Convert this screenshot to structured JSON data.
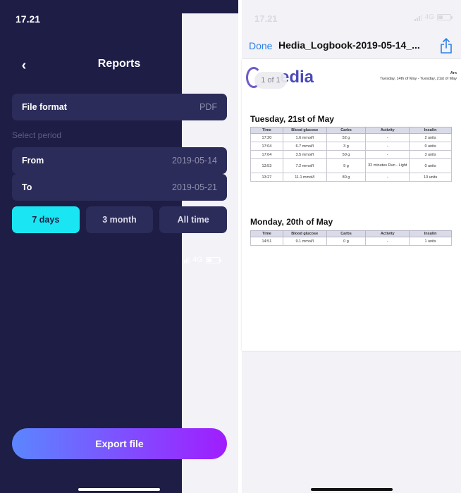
{
  "left": {
    "status": {
      "time": "17.21",
      "network": "4G"
    },
    "header": {
      "title": "Reports"
    },
    "file_format": {
      "label": "File format",
      "value": "PDF"
    },
    "period_hint": "Select period",
    "from": {
      "label": "From",
      "value": "2019-05-14"
    },
    "to": {
      "label": "To",
      "value": "2019-05-21"
    },
    "periods": [
      "7 days",
      "3 month",
      "All time"
    ],
    "export_label": "Export file",
    "colors": {
      "bg": "#1d1d46",
      "row": "#2c2c5a",
      "active": "#19e6f2",
      "gradient_start": "#5b86ff",
      "gradient_end": "#a01dff"
    }
  },
  "right": {
    "status": {
      "time": "17.21",
      "network": "4G"
    },
    "done_label": "Done",
    "file_name": "Hedia_Logbook-2019-05-14_...",
    "page_badge": "1 of 1",
    "logo_text": "edia",
    "doc_header": {
      "name": "Arx",
      "range": "Tuesday, 14th of May - Tuesday, 21st of May"
    },
    "columns": [
      "Time",
      "Blood glucose",
      "Carbs",
      "Activity",
      "Insulin"
    ],
    "days": [
      {
        "title": "Tuesday, 21st of May",
        "rows": [
          [
            "17:20",
            "1.6 mmol/l",
            "52 g",
            "-",
            "2 units"
          ],
          [
            "17:04",
            "6.7 mmol/l",
            "3 g",
            "-",
            "0 units"
          ],
          [
            "17:04",
            "3.5 mmol/l",
            "50 g",
            "-",
            "3 units"
          ],
          [
            "13:53",
            "7.2 mmol/l",
            "9 g",
            "32 minutes Run - Light",
            "0 units"
          ],
          [
            "13:27",
            "11.1 mmol/l",
            "80 g",
            "-",
            "10 units"
          ]
        ]
      },
      {
        "title": "Monday, 20th of May",
        "rows": [
          [
            "14:51",
            "9.1 mmol/l",
            "0 g",
            "-",
            "1 units"
          ]
        ]
      }
    ],
    "colors": {
      "link": "#2b7fe8",
      "logo": "#4a4ab8"
    }
  }
}
